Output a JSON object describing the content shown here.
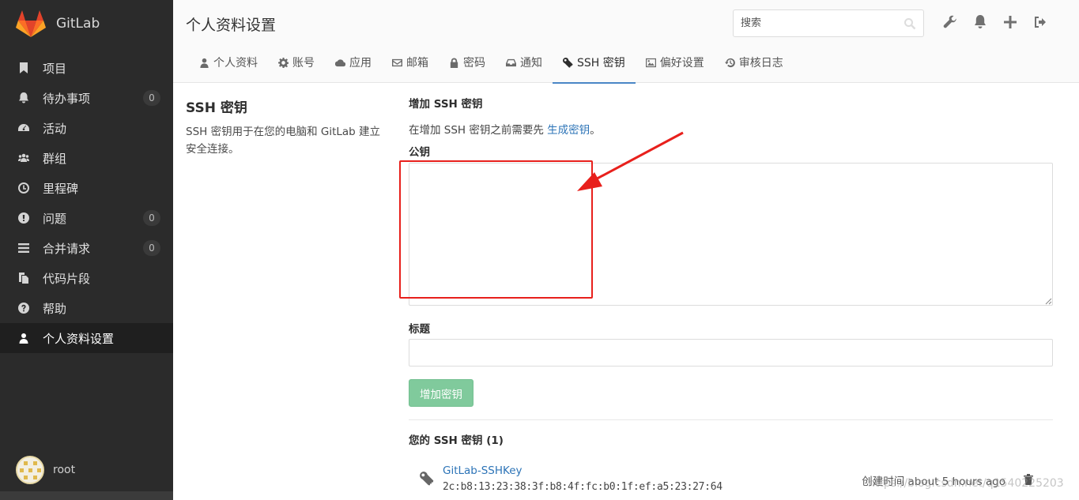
{
  "app": {
    "name": "GitLab",
    "brand_color": "#e2432a"
  },
  "sidebar": {
    "items": [
      {
        "label": "项目",
        "icon": "bookmark-icon",
        "count": null
      },
      {
        "label": "待办事项",
        "icon": "bell-icon",
        "count": "0"
      },
      {
        "label": "活动",
        "icon": "dashboard-icon",
        "count": null
      },
      {
        "label": "群组",
        "icon": "users-icon",
        "count": null
      },
      {
        "label": "里程碑",
        "icon": "clock-icon",
        "count": null
      },
      {
        "label": "问题",
        "icon": "exclamation-icon",
        "count": "0"
      },
      {
        "label": "合并请求",
        "icon": "list-icon",
        "count": "0"
      },
      {
        "label": "代码片段",
        "icon": "copy-icon",
        "count": null
      },
      {
        "label": "帮助",
        "icon": "question-icon",
        "count": null
      },
      {
        "label": "个人资料设置",
        "icon": "user-icon",
        "count": null,
        "active": true
      }
    ],
    "user": {
      "name": "root"
    }
  },
  "header": {
    "title": "个人资料设置",
    "search_placeholder": "搜索",
    "icons": [
      "wrench-icon",
      "bell-icon",
      "plus-icon",
      "sign-out-icon"
    ]
  },
  "tabs": [
    {
      "label": "个人资料",
      "icon": "user-icon"
    },
    {
      "label": "账号",
      "icon": "gear-icon"
    },
    {
      "label": "应用",
      "icon": "cloud-icon"
    },
    {
      "label": "邮箱",
      "icon": "envelope-icon"
    },
    {
      "label": "密码",
      "icon": "lock-icon"
    },
    {
      "label": "通知",
      "icon": "inbox-icon"
    },
    {
      "label": "SSH 密钥",
      "icon": "key-icon",
      "active": true
    },
    {
      "label": "偏好设置",
      "icon": "image-icon"
    },
    {
      "label": "审核日志",
      "icon": "history-icon"
    }
  ],
  "left": {
    "title": "SSH 密钥",
    "description": "SSH 密钥用于在您的电脑和 GitLab 建立安全连接。"
  },
  "form": {
    "heading": "增加 SSH 密钥",
    "hint_prefix": "在增加 SSH 密钥之前需要先 ",
    "hint_link": "生成密钥",
    "hint_suffix": "。",
    "key_label": "公钥",
    "key_value": "",
    "title_label": "标题",
    "title_value": "",
    "submit_label": "增加密钥",
    "submit_color": "#80ca9c"
  },
  "keys": {
    "heading": "您的 SSH 密钥 (1)",
    "items": [
      {
        "name": "GitLab-SSHKey",
        "fingerprint": "2c:b8:13:23:38:3f:b8:4f:fc:b0:1f:ef:a5:23:27:64",
        "created": "创建时间 about 5 hours ago"
      }
    ]
  },
  "watermark": "https://blog.csdn.net/q1540225203",
  "annotation_color": "#e8201c"
}
